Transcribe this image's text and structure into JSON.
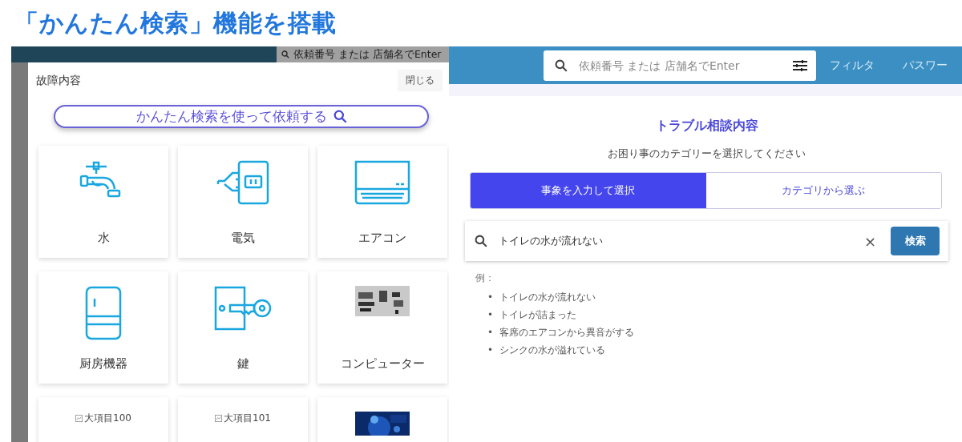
{
  "headline": "「かんたん検索」機能を搭載",
  "background_app": {
    "search": {
      "placeholder": "依頼番号 または 店舗名でEnter"
    }
  },
  "modal": {
    "title": "故障内容",
    "close": "閉じる",
    "easy_search_button": "かんたん検索を使って依頼する",
    "categories": [
      {
        "kind": "faucet",
        "label": "水"
      },
      {
        "kind": "plug",
        "label": "電気"
      },
      {
        "kind": "aircon",
        "label": "エアコン"
      },
      {
        "kind": "fridge",
        "label": "厨房機器"
      },
      {
        "kind": "key",
        "label": "鍵"
      },
      {
        "label": "コンピューター"
      },
      {
        "kind": "broken",
        "label": "大項目100"
      },
      {
        "kind": "broken",
        "label": "大項目101"
      },
      {
        "kind": "photo-dark"
      }
    ]
  },
  "header": {
    "search": {
      "placeholder": "依頼番号 または 店舗名でEnter"
    },
    "nav": [
      "フィルタ",
      "パスワー"
    ]
  },
  "panel": {
    "title": "トラブル相談内容",
    "subtitle": "お困り事のカテゴリーを選択してください",
    "tabs": [
      {
        "label": "事象を入力して選択",
        "selected": true
      },
      {
        "label": "カテゴリから選ぶ",
        "selected": false
      }
    ],
    "search": {
      "value": "トイレの水が流れない",
      "clear": "×",
      "button": "検索"
    },
    "bullet": "•",
    "examples_label": "例：",
    "examples": [
      "トイレの水が流れない",
      "トイレが詰まった",
      "客席のエアコンから異音がする",
      "シンクの水が溢れている"
    ]
  }
}
